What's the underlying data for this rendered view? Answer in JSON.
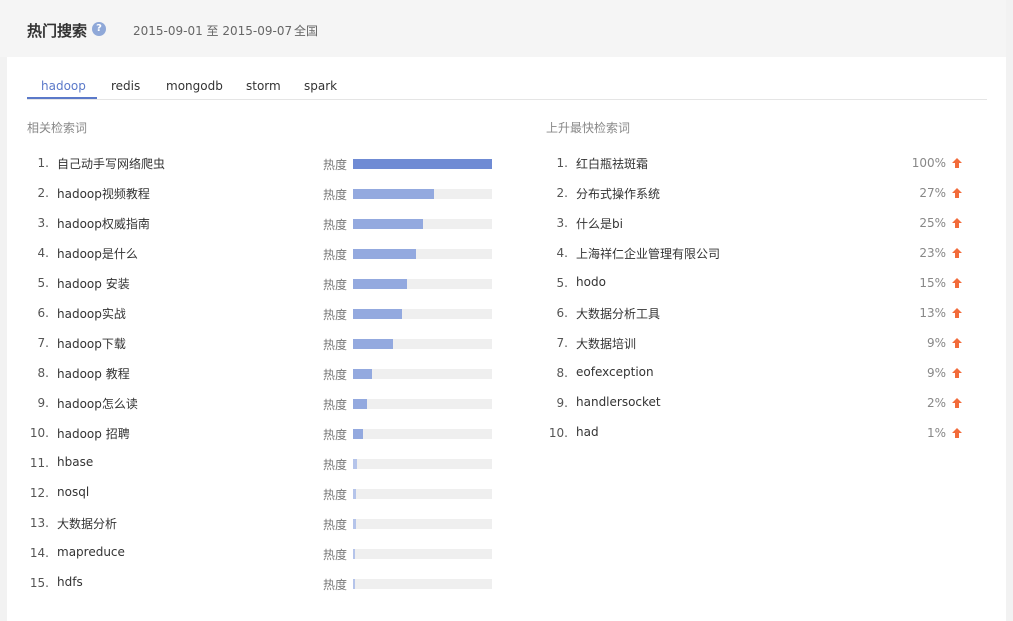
{
  "header": {
    "title": "热门搜索",
    "help_icon": "question-icon",
    "date_range": "2015-09-01 至 2015-09-07",
    "region": "全国"
  },
  "tabs": [
    {
      "label": "hadoop",
      "active": true
    },
    {
      "label": "redis",
      "active": false
    },
    {
      "label": "mongodb",
      "active": false
    },
    {
      "label": "storm",
      "active": false
    },
    {
      "label": "spark",
      "active": false
    }
  ],
  "related": {
    "title": "相关检索词",
    "heat_label": "热度",
    "items": [
      {
        "index": "1.",
        "keyword": "自己动手写网络爬虫",
        "heat": 1.0
      },
      {
        "index": "2.",
        "keyword": "hadoop视频教程",
        "heat": 0.58
      },
      {
        "index": "3.",
        "keyword": "hadoop权威指南",
        "heat": 0.5
      },
      {
        "index": "4.",
        "keyword": "hadoop是什么",
        "heat": 0.45
      },
      {
        "index": "5.",
        "keyword": "hadoop 安装",
        "heat": 0.39
      },
      {
        "index": "6.",
        "keyword": "hadoop实战",
        "heat": 0.35
      },
      {
        "index": "7.",
        "keyword": "hadoop下载",
        "heat": 0.29
      },
      {
        "index": "8.",
        "keyword": "hadoop 教程",
        "heat": 0.14
      },
      {
        "index": "9.",
        "keyword": "hadoop怎么读",
        "heat": 0.1
      },
      {
        "index": "10.",
        "keyword": "hadoop 招聘",
        "heat": 0.07
      },
      {
        "index": "11.",
        "keyword": "hbase",
        "heat": 0.03
      },
      {
        "index": "12.",
        "keyword": "nosql",
        "heat": 0.02
      },
      {
        "index": "13.",
        "keyword": "大数据分析",
        "heat": 0.02
      },
      {
        "index": "14.",
        "keyword": "mapreduce",
        "heat": 0.015
      },
      {
        "index": "15.",
        "keyword": "hdfs",
        "heat": 0.015
      }
    ]
  },
  "rising": {
    "title": "上升最快检索词",
    "up_icon": "arrow-up-icon",
    "items": [
      {
        "index": "1.",
        "keyword": "红白瓶祛斑霜",
        "percent": "100%"
      },
      {
        "index": "2.",
        "keyword": "分布式操作系统",
        "percent": "27%"
      },
      {
        "index": "3.",
        "keyword": "什么是bi",
        "percent": "25%"
      },
      {
        "index": "4.",
        "keyword": "上海祥仁企业管理有限公司",
        "percent": "23%"
      },
      {
        "index": "5.",
        "keyword": "hodo",
        "percent": "15%"
      },
      {
        "index": "6.",
        "keyword": "大数据分析工具",
        "percent": "13%"
      },
      {
        "index": "7.",
        "keyword": "大数据培训",
        "percent": "9%"
      },
      {
        "index": "8.",
        "keyword": "eofexception",
        "percent": "9%"
      },
      {
        "index": "9.",
        "keyword": "handlersocket",
        "percent": "2%"
      },
      {
        "index": "10.",
        "keyword": "had",
        "percent": "1%"
      }
    ]
  },
  "colors": {
    "bar_top": "#6f8bd4",
    "bar_mid": "#93a9df",
    "bar_low": "#b5c4ea",
    "up_arrow": "#f26b3a",
    "accent": "#5b79c9"
  }
}
